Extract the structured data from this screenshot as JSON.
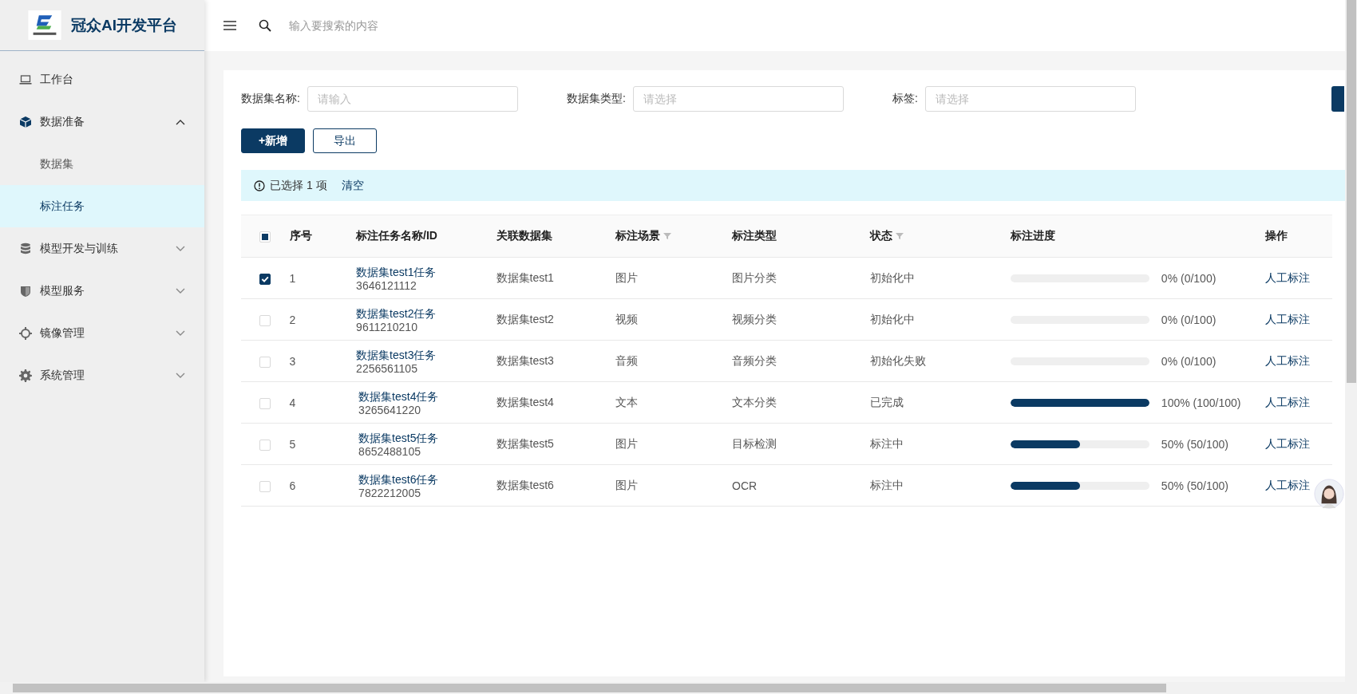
{
  "sidebar": {
    "title": "冠众AI开发平台",
    "items": [
      {
        "label": "工作台",
        "kind": "link",
        "selected": false
      },
      {
        "label": "数据准备",
        "kind": "group",
        "expanded": true,
        "selected": false,
        "children": [
          {
            "label": "数据集",
            "selected": false
          },
          {
            "label": "标注任务",
            "selected": true
          }
        ]
      },
      {
        "label": "模型开发与训练",
        "kind": "group",
        "expanded": false,
        "selected": false
      },
      {
        "label": "模型服务",
        "kind": "group",
        "expanded": false,
        "selected": false
      },
      {
        "label": "镜像管理",
        "kind": "group",
        "expanded": false,
        "selected": false
      },
      {
        "label": "系统管理",
        "kind": "group",
        "expanded": false,
        "selected": false
      }
    ]
  },
  "search": {
    "placeholder": "输入要搜索的内容"
  },
  "filters": [
    {
      "label": "数据集名称:",
      "placeholder": "请输入"
    },
    {
      "label": "数据集类型:",
      "placeholder": "请选择"
    },
    {
      "label": "标签:",
      "placeholder": "请选择"
    }
  ],
  "buttons": [
    {
      "label": "+新增",
      "kind": "primary"
    },
    {
      "label": "导出",
      "kind": "outline"
    }
  ],
  "alert": {
    "text": "已选择 1 项",
    "link": "清空"
  },
  "table": {
    "select_all": {
      "checked": false,
      "indeterminate": true
    },
    "columns": [
      {
        "label": "序号",
        "filter": false
      },
      {
        "label": "标注任务名称/ID",
        "filter": false
      },
      {
        "label": "关联数据集",
        "filter": false
      },
      {
        "label": "标注场景",
        "filter": true
      },
      {
        "label": "标注类型",
        "filter": false
      },
      {
        "label": "状态",
        "filter": true
      },
      {
        "label": "标注进度",
        "filter": false
      },
      {
        "label": "操作",
        "filter": false
      }
    ],
    "rows": [
      {
        "selected": true,
        "no": "1",
        "name": "数据集test1任务",
        "id": "3646121112",
        "dataset": "数据集test1",
        "scene": "图片",
        "type": "图片分类",
        "status": "初始化中",
        "level": 0,
        "progress": "0% (0/100)",
        "action": "人工标注"
      },
      {
        "selected": false,
        "no": "2",
        "name": "数据集test2任务",
        "id": "9611210210",
        "dataset": "数据集test2",
        "scene": "视频",
        "type": "视频分类",
        "status": "初始化中",
        "level": 0,
        "progress": "0% (0/100)",
        "action": "人工标注"
      },
      {
        "selected": false,
        "no": "3",
        "name": "数据集test3任务",
        "id": "2256561105",
        "dataset": "数据集test3",
        "scene": "音频",
        "type": "音频分类",
        "status": "初始化失败",
        "level": 0,
        "progress": "0% (0/100)",
        "action": "人工标注"
      },
      {
        "selected": false,
        "no": "4",
        "name": "数据集test4任务",
        "id": "3265641220",
        "dataset": "数据集test4",
        "scene": "文本",
        "type": "文本分类",
        "status": "已完成",
        "level": 1,
        "progress": "100% (100/100)",
        "action": "人工标注"
      },
      {
        "selected": false,
        "no": "5",
        "name": "数据集test5任务",
        "id": "8652488105",
        "dataset": "数据集test5",
        "scene": "图片",
        "type": "目标检测",
        "status": "标注中",
        "level": 0.5,
        "progress": "50% (50/100)",
        "action": "人工标注"
      },
      {
        "selected": false,
        "no": "6",
        "name": "数据集test6任务",
        "id": "7822212005",
        "dataset": "数据集test6",
        "scene": "图片",
        "type": "OCR",
        "status": "标注中",
        "level": 0.5,
        "progress": "50% (50/100)",
        "action": "人工标注"
      }
    ]
  }
}
